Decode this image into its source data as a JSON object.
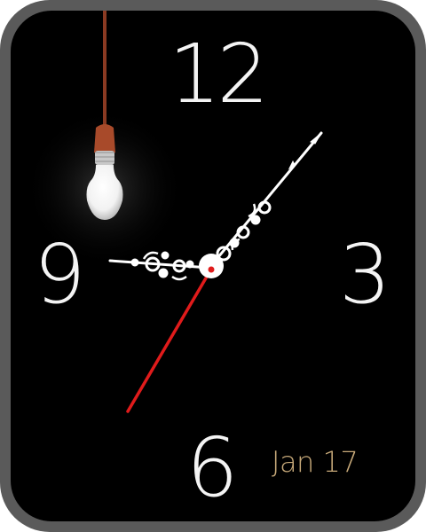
{
  "watch_face": {
    "numerals": {
      "twelve": "12",
      "three": "3",
      "six": "6",
      "nine": "9"
    },
    "date": "Jan 17",
    "colors": {
      "background": "#000000",
      "bezel": "#5a5a5a",
      "numerals": "#f4f4f4",
      "date_text": "#c8aa7a",
      "second_hand": "#e01b1b",
      "hands": "#ffffff",
      "bulb_socket": "#a84a2a"
    },
    "decoration": "hanging-light-bulb-icon"
  }
}
